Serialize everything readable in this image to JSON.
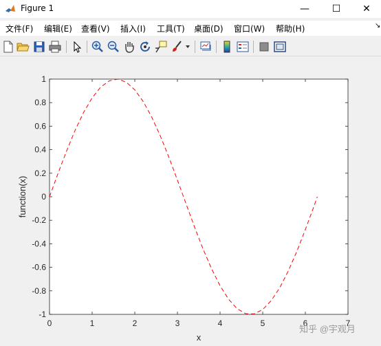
{
  "window": {
    "title": "Figure 1",
    "minimize_glyph": "—",
    "maximize_glyph": "☐",
    "close_glyph": "✕"
  },
  "menu": [
    "文件(F)",
    "编辑(E)",
    "查看(V)",
    "插入(I)",
    "工具(T)",
    "桌面(D)",
    "窗口(W)",
    "帮助(H)"
  ],
  "menu_dock_glyph": "↘",
  "toolbar_icons": [
    "new-figure-icon",
    "open-folder-icon",
    "save-icon",
    "print-icon",
    "select-arrow-icon",
    "zoom-in-icon",
    "zoom-out-icon",
    "pan-hand-icon",
    "rotate-3d-icon",
    "data-cursor-icon",
    "brush-icon",
    "link-plot-icon",
    "colorbar-icon",
    "legend-icon",
    "hide-plot-tools-icon",
    "show-plot-tools-icon"
  ],
  "watermark": "知乎 @宇观月",
  "chart_data": {
    "type": "line",
    "xlabel": "x",
    "ylabel": "function(x)",
    "xlim": [
      0,
      7
    ],
    "ylim": [
      -1,
      1
    ],
    "xticks": [
      0,
      1,
      2,
      3,
      4,
      5,
      6,
      7
    ],
    "yticks": [
      -1,
      -0.8,
      -0.6,
      -0.4,
      -0.2,
      0,
      0.2,
      0.4,
      0.6,
      0.8,
      1
    ],
    "grid": false,
    "series": [
      {
        "color": "#ff0000",
        "line_style": "dashed",
        "x": [
          0,
          0.2,
          0.4,
          0.6,
          0.8,
          1.0,
          1.2,
          1.4,
          1.6,
          1.8,
          2.0,
          2.2,
          2.4,
          2.6,
          2.8,
          3.0,
          3.2,
          3.4,
          3.6,
          3.8,
          4.0,
          4.2,
          4.4,
          4.6,
          4.8,
          5.0,
          5.2,
          5.4,
          5.6,
          5.8,
          6.0,
          6.2,
          6.28
        ],
        "y": [
          0,
          0.199,
          0.389,
          0.565,
          0.717,
          0.841,
          0.932,
          0.985,
          1.0,
          0.974,
          0.909,
          0.808,
          0.675,
          0.516,
          0.335,
          0.141,
          -0.058,
          -0.256,
          -0.443,
          -0.612,
          -0.757,
          -0.872,
          -0.952,
          -0.994,
          -0.996,
          -0.959,
          -0.883,
          -0.773,
          -0.631,
          -0.465,
          -0.279,
          -0.083,
          0
        ]
      }
    ]
  },
  "colors": {
    "plot_line": "#ff0000",
    "axes_background": "#ffffff",
    "figure_background": "#f0f0f0"
  }
}
